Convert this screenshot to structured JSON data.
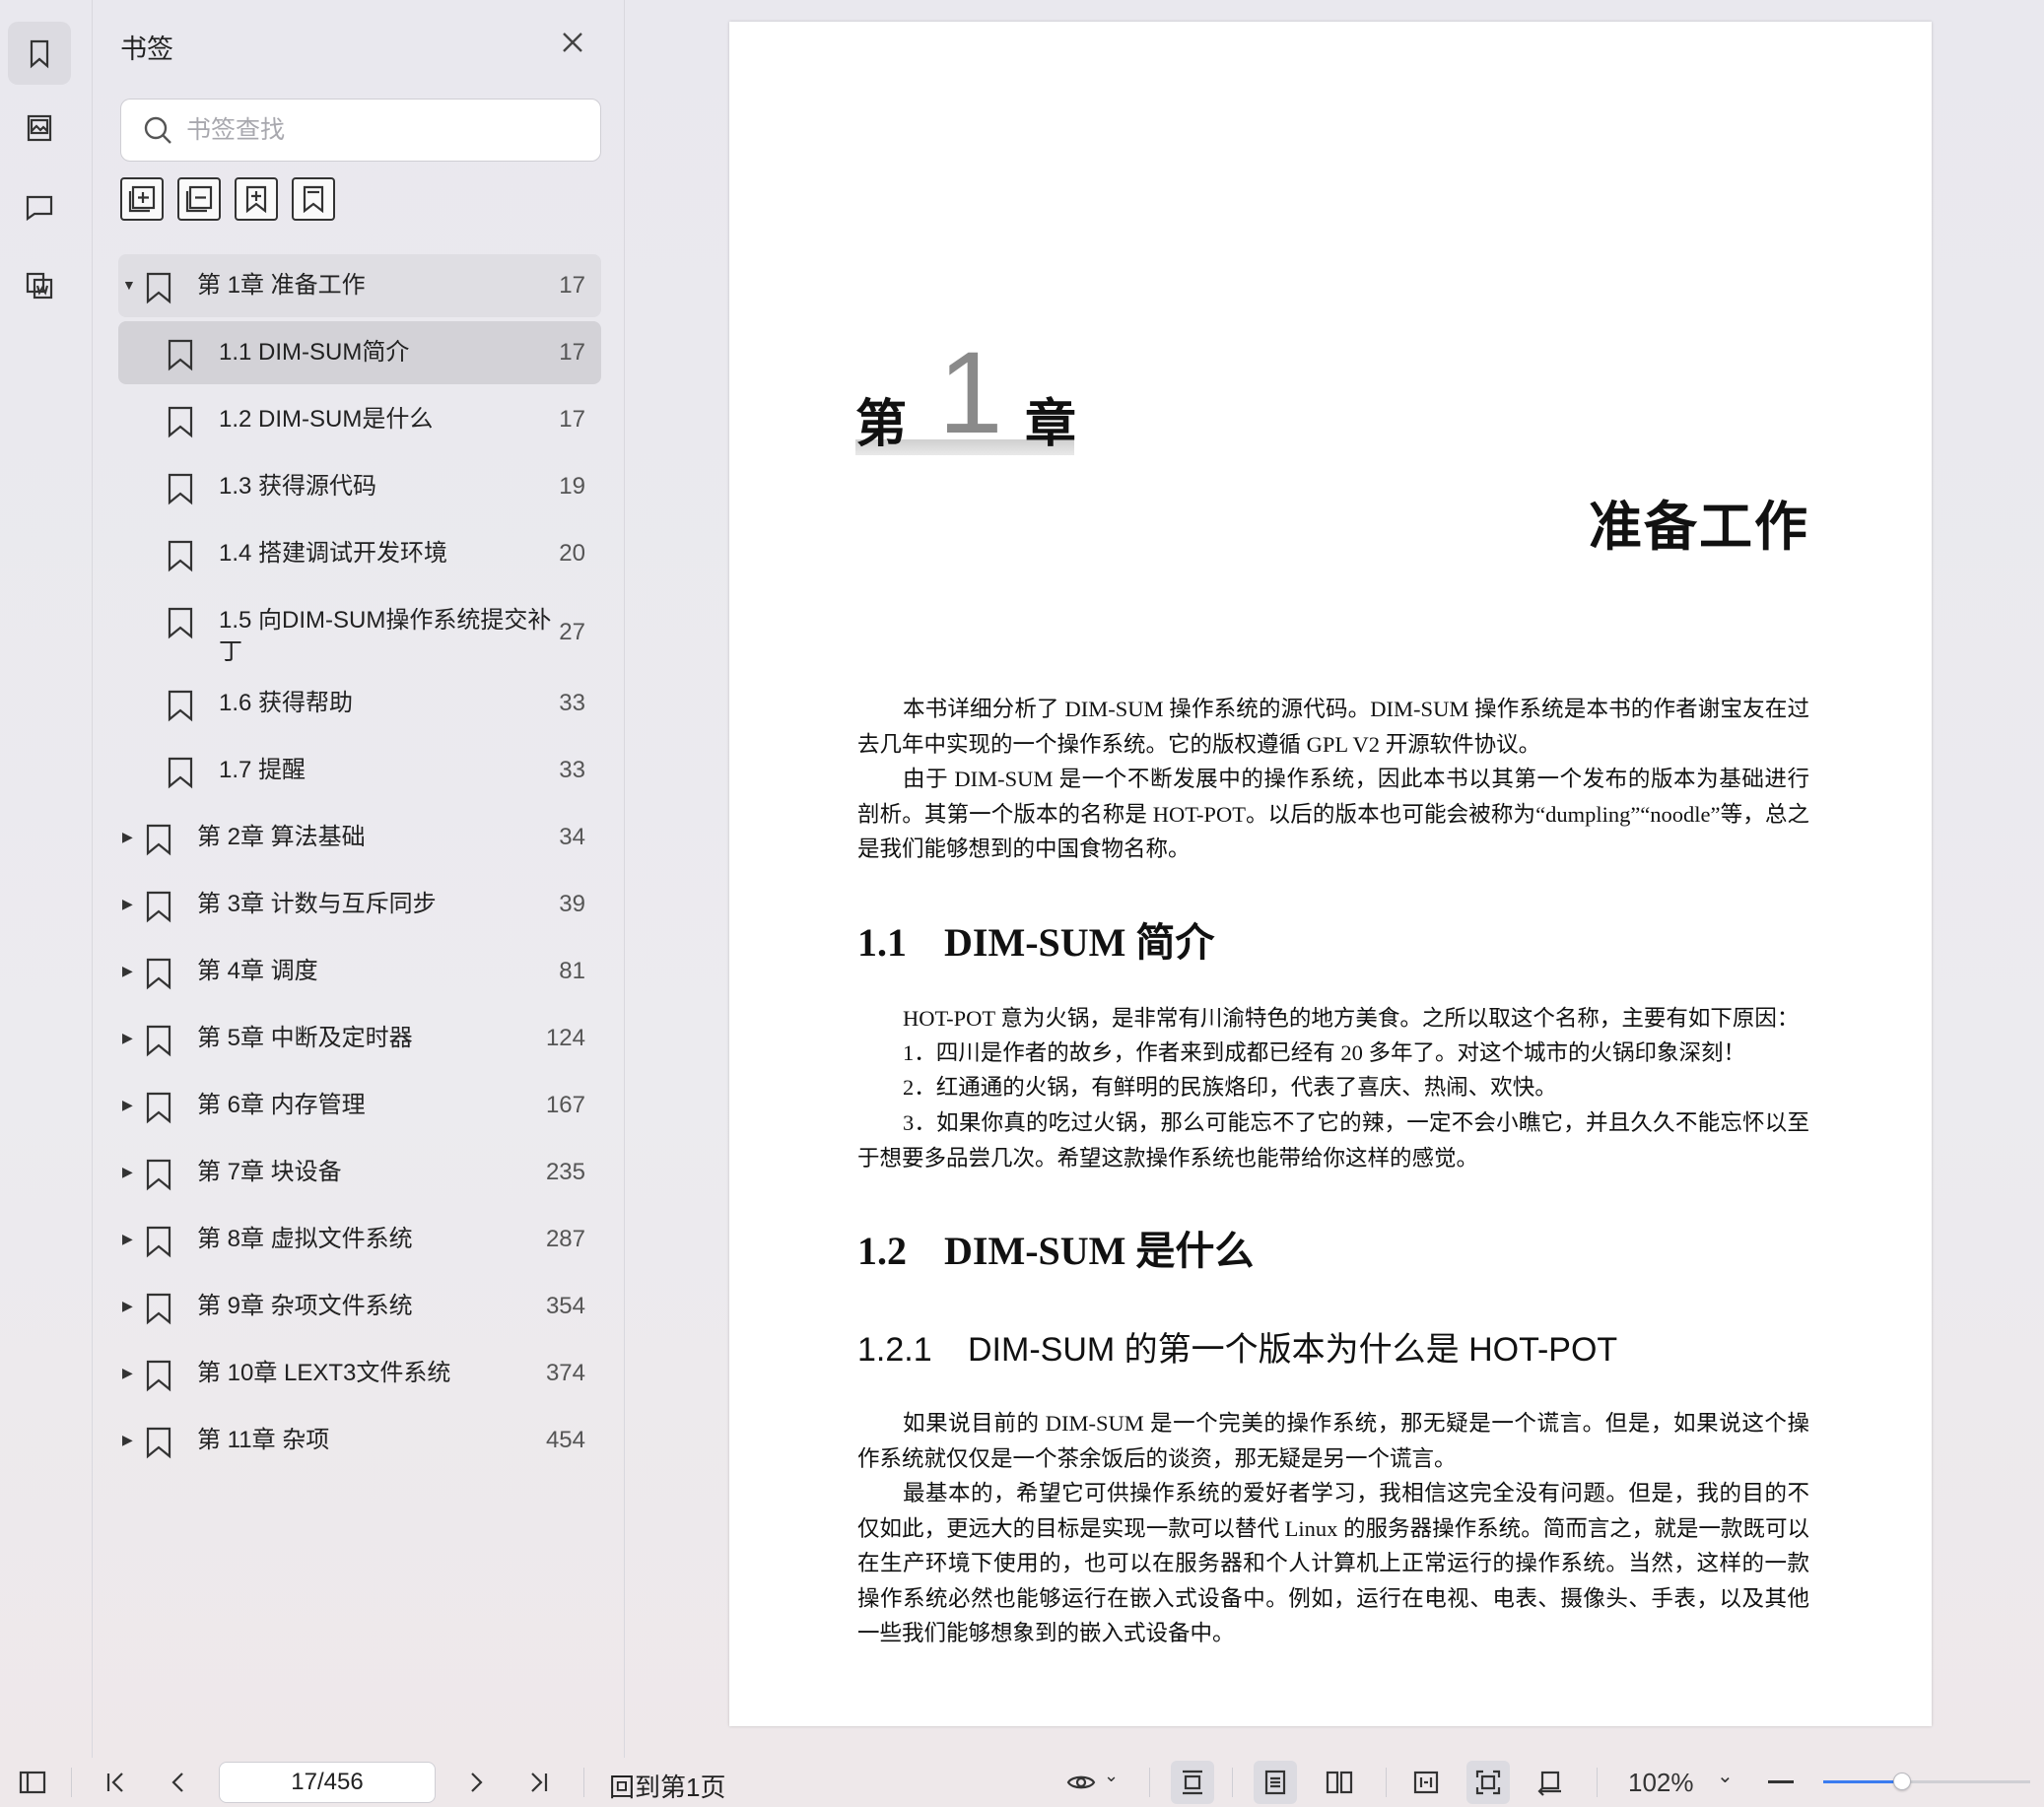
{
  "sidebar": {
    "title": "书签",
    "search_placeholder": "书签查找",
    "tools": [
      {
        "icon": "expand-all-icon"
      },
      {
        "icon": "collapse-all-icon"
      },
      {
        "icon": "add-bookmark-icon"
      },
      {
        "icon": "bookmark-icon"
      }
    ],
    "items": [
      {
        "label": "第 1章 准备工作",
        "page": "17",
        "level": 0,
        "state": "expanded"
      },
      {
        "label": "1.1 DIM-SUM简介",
        "page": "17",
        "level": 1,
        "state": "selected"
      },
      {
        "label": "1.2 DIM-SUM是什么",
        "page": "17",
        "level": 1,
        "state": ""
      },
      {
        "label": "1.3 获得源代码",
        "page": "19",
        "level": 1,
        "state": ""
      },
      {
        "label": "1.4 搭建调试开发环境",
        "page": "20",
        "level": 1,
        "state": ""
      },
      {
        "label": "1.5 向DIM-SUM操作系统提交补丁",
        "page": "27",
        "level": 1,
        "state": "tall"
      },
      {
        "label": "1.6 获得帮助",
        "page": "33",
        "level": 1,
        "state": ""
      },
      {
        "label": "1.7 提醒",
        "page": "33",
        "level": 1,
        "state": ""
      },
      {
        "label": "第 2章 算法基础",
        "page": "34",
        "level": 0,
        "state": "collapsed"
      },
      {
        "label": "第 3章 计数与互斥同步",
        "page": "39",
        "level": 0,
        "state": "collapsed"
      },
      {
        "label": "第 4章 调度",
        "page": "81",
        "level": 0,
        "state": "collapsed"
      },
      {
        "label": "第 5章 中断及定时器",
        "page": "124",
        "level": 0,
        "state": "collapsed"
      },
      {
        "label": "第 6章 内存管理",
        "page": "167",
        "level": 0,
        "state": "collapsed"
      },
      {
        "label": "第 7章 块设备",
        "page": "235",
        "level": 0,
        "state": "collapsed"
      },
      {
        "label": "第 8章 虚拟文件系统",
        "page": "287",
        "level": 0,
        "state": "collapsed"
      },
      {
        "label": "第 9章 杂项文件系统",
        "page": "354",
        "level": 0,
        "state": "collapsed"
      },
      {
        "label": "第 10章 LEXT3文件系统",
        "page": "374",
        "level": 0,
        "state": "collapsed"
      },
      {
        "label": "第 11章 杂项",
        "page": "454",
        "level": 0,
        "state": "collapsed"
      }
    ]
  },
  "document": {
    "chapter_prefix": "第",
    "chapter_number": "1",
    "chapter_suffix": "章",
    "chapter_title": "准备工作",
    "intro_p1": "本书详细分析了 DIM-SUM 操作系统的源代码。DIM-SUM 操作系统是本书的作者谢宝友在过去几年中实现的一个操作系统。它的版权遵循 GPL V2 开源软件协议。",
    "intro_p2": "由于 DIM-SUM 是一个不断发展中的操作系统，因此本书以其第一个发布的版本为基础进行剖析。其第一个版本的名称是 HOT-POT。以后的版本也可能会被称为“dumpling”“noodle”等，总之是我们能够想到的中国食物名称。",
    "s11_num": "1.1",
    "s11_title": "DIM-SUM 简介",
    "s11_p1": "HOT-POT 意为火锅，是非常有川渝特色的地方美食。之所以取这个名称，主要有如下原因：",
    "s11_l1": "1．四川是作者的故乡，作者来到成都已经有 20 多年了。对这个城市的火锅印象深刻！",
    "s11_l2": "2．红通通的火锅，有鲜明的民族烙印，代表了喜庆、热闹、欢快。",
    "s11_l3": "3．如果你真的吃过火锅，那么可能忘不了它的辣，一定不会小瞧它，并且久久不能忘怀以至于想要多品尝几次。希望这款操作系统也能带给你这样的感觉。",
    "s12_num": "1.2",
    "s12_title": "DIM-SUM 是什么",
    "s121_num": "1.2.1",
    "s121_title": "DIM-SUM 的第一个版本为什么是 HOT-POT",
    "s121_p1": "如果说目前的 DIM-SUM 是一个完美的操作系统，那无疑是一个谎言。但是，如果说这个操作系统就仅仅是一个茶余饭后的谈资，那无疑是另一个谎言。",
    "s121_p2": "最基本的，希望它可供操作系统的爱好者学习，我相信这完全没有问题。但是，我的目的不仅如此，更远大的目标是实现一款可以替代 Linux 的服务器操作系统。简而言之，就是一款既可以在生产环境下使用的，也可以在服务器和个人计算机上正常运行的操作系统。当然，这样的一款操作系统必然也能够运行在嵌入式设备中。例如，运行在电视、电表、摄像头、手表，以及其他一些我们能够想象到的嵌入式设备中。"
  },
  "toolbar": {
    "page_indicator": "17/456",
    "goto_first": "回到第1页",
    "zoom": "102%",
    "zoom_slider_fraction": 0.38
  }
}
